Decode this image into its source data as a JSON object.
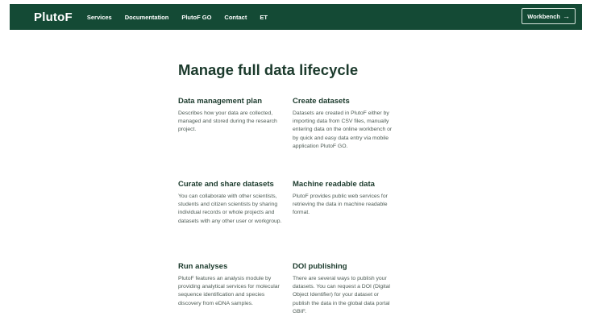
{
  "navbar": {
    "logo": "PlutoF",
    "links": [
      "Services",
      "Documentation",
      "PlutoF GO",
      "Contact",
      "ET"
    ],
    "workbench_label": "Workbench",
    "workbench_arrow": "→",
    "bg_color": "#144a35"
  },
  "main": {
    "headline": "Manage full data lifecycle",
    "features": [
      {
        "title": "Data management plan",
        "text": "Describes how your data are collected, managed and stored during the research project."
      },
      {
        "title": "Create datasets",
        "text": "Datasets are created in PlutoF either by importing data from CSV files, manually entering data on the online workbench or by quick and easy data entry via mobile application PlutoF GO."
      },
      {
        "title": "Curate and share datasets",
        "text": "You can collaborate with other scientists, students and citizen scientists by sharing individual records or whole projects and datasets with any other user or workgroup."
      },
      {
        "title": "Machine readable data",
        "text": "PlutoF provides public web services for retrieving the data in machine readable format."
      },
      {
        "title": "Run analyses",
        "text": "PlutoF features an analysis module by providing analytical services for molecular sequence identification and species discovery from eDNA samples."
      },
      {
        "title": "DOI publishing",
        "text": "There are several ways to publish your datasets. You can request a DOI (Digital Object Identifier) for your dataset or publish the data in the global data portal GBIF."
      }
    ]
  }
}
